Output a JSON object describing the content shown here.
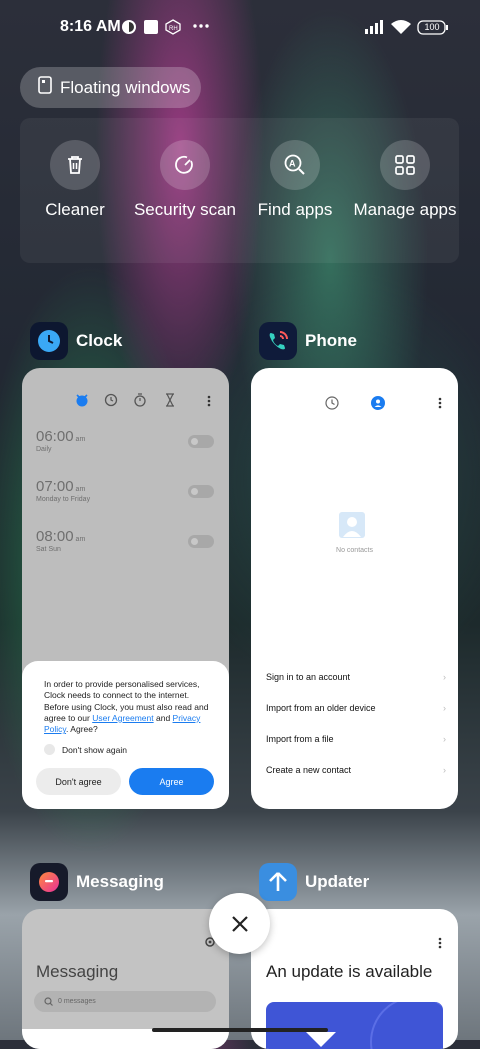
{
  "status_bar": {
    "time": "8:16 AM",
    "battery": "100"
  },
  "floating_windows": {
    "label": "Floating windows"
  },
  "tools": [
    {
      "label": "Cleaner",
      "icon": "trash-icon"
    },
    {
      "label": "Security scan",
      "icon": "shield-scan-icon"
    },
    {
      "label": "Find apps",
      "icon": "search-app-icon"
    },
    {
      "label": "Manage apps",
      "icon": "grid-icon"
    }
  ],
  "apps": {
    "clock": {
      "name": "Clock",
      "alarms": [
        {
          "time": "06:00",
          "ampm": "am",
          "days": "Daily"
        },
        {
          "time": "07:00",
          "ampm": "am",
          "days": "Monday to Friday"
        },
        {
          "time": "08:00",
          "ampm": "am",
          "days": "Sat Sun"
        }
      ],
      "dialog": {
        "text_before": "In order to provide personalised services, Clock needs to connect to the internet. Before using Clock, you must also read and agree to our ",
        "link1": "User Agreement",
        "and": " and ",
        "link2": "Privacy Policy",
        "text_after": ". Agree?",
        "checkbox": "Don't show again",
        "disagree": "Don't agree",
        "agree": "Agree"
      }
    },
    "phone": {
      "name": "Phone",
      "empty": "No contacts",
      "options": [
        "Sign in to an account",
        "Import from an older device",
        "Import from a file",
        "Create a new contact"
      ]
    },
    "messaging": {
      "name": "Messaging",
      "title": "Messaging",
      "search": "0 messages"
    },
    "updater": {
      "name": "Updater",
      "title": "An update is available"
    }
  },
  "colors": {
    "accent": "#1a7cf0",
    "phone_bg": "#0f1b3a",
    "updater_bg": "#3a8ee0"
  }
}
